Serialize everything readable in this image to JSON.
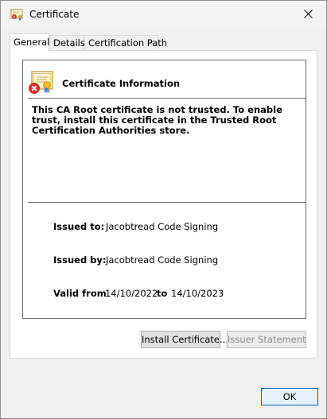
{
  "window": {
    "title": "Certificate"
  },
  "tabs": [
    {
      "label": "General"
    },
    {
      "label": "Details"
    },
    {
      "label": "Certification Path"
    }
  ],
  "general": {
    "heading": "Certificate Information",
    "warning": "This CA Root certificate is not trusted. To enable trust, install this certificate in the Trusted Root Certification Authorities store.",
    "issued_to_label": "Issued to:",
    "issued_to_value": "Jacobtread Code Signing",
    "issued_by_label": "Issued by:",
    "issued_by_value": "Jacobtread Code Signing",
    "valid_from_label": "Valid from",
    "valid_from_value": "14/10/2022",
    "valid_to_label": "to",
    "valid_to_value": "14/10/2023"
  },
  "buttons": {
    "install": "Install Certificate...",
    "issuer_statement": "Issuer Statement",
    "ok": "OK"
  },
  "icons": {
    "title": "certificate-icon",
    "close": "close-icon",
    "cert_error": "certificate-error-icon"
  }
}
